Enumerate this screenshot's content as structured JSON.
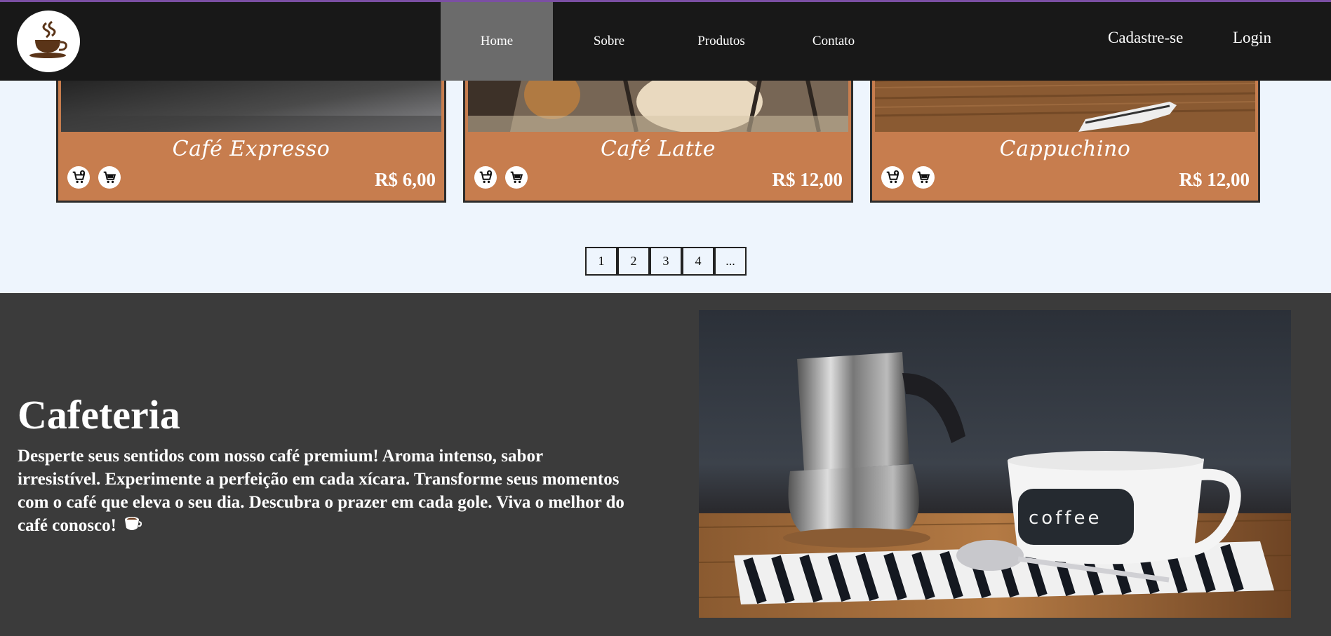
{
  "header": {
    "logo_icon": "coffee-cup-logo",
    "nav": [
      {
        "label": "Home",
        "active": true
      },
      {
        "label": "Sobre",
        "active": false
      },
      {
        "label": "Produtos",
        "active": false
      },
      {
        "label": "Contato",
        "active": false
      }
    ],
    "signup_label": "Cadastre-se",
    "login_label": "Login"
  },
  "products": [
    {
      "name": "Café Expresso",
      "price": "R$ 6,00",
      "icons": [
        "add-to-cart-icon",
        "cart-icon"
      ]
    },
    {
      "name": "Café Latte",
      "price": "R$ 12,00",
      "icons": [
        "add-to-cart-icon",
        "cart-icon"
      ]
    },
    {
      "name": "Cappuchino",
      "price": "R$ 12,00",
      "icons": [
        "add-to-cart-icon",
        "cart-icon"
      ]
    }
  ],
  "pagination": [
    "1",
    "2",
    "3",
    "4",
    "..."
  ],
  "hero": {
    "title": "Cafeteria",
    "text": "Desperte seus sentidos com nosso café premium! Aroma intenso, sabor irresistível. Experimente a perfeição em cada xícara. Transforme seus momentos com o café que eleva o seu dia. Descubra o prazer em cada gole. Viva o melhor do café conosco!",
    "emoji_icon": "coffee-emoji-icon"
  },
  "colors": {
    "header_bg": "#181818",
    "nav_active": "#6b6b6b",
    "card_bg": "#c77d4e",
    "page_bg": "#eef5fd",
    "hero_bg": "#3b3b3b",
    "accent_line": "#7b4fa3"
  }
}
